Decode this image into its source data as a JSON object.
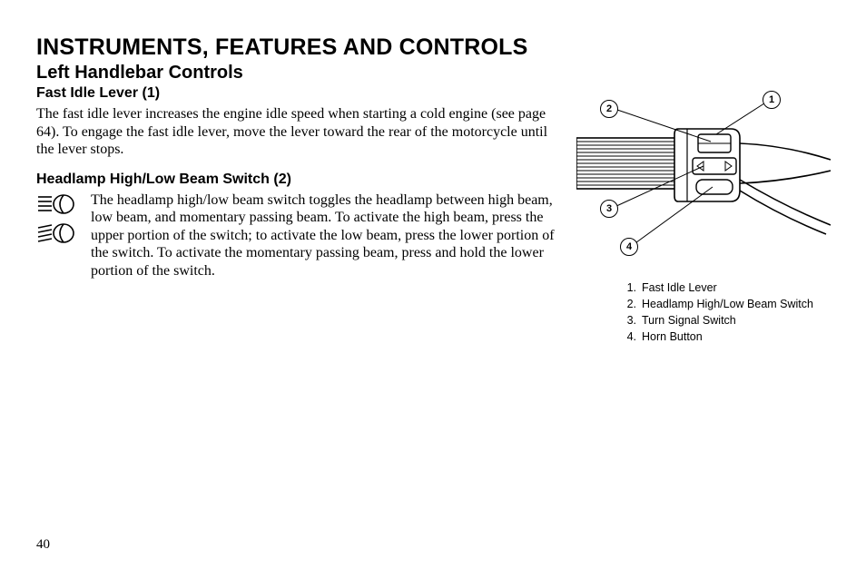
{
  "page_number": "40",
  "doc_title": "INSTRUMENTS, FEATURES AND CONTROLS",
  "section_title": "Left Handlebar Controls",
  "subsection1": {
    "title": "Fast Idle Lever (1)",
    "body": "The fast idle lever increases the engine idle speed when starting a cold engine (see page 64). To engage the fast idle lever, move the lever toward the rear of the motorcycle until the lever stops."
  },
  "subsection2": {
    "title": "Headlamp High/Low Beam Switch (2)",
    "body": "The headlamp high/low beam switch toggles the headlamp between high beam, low beam, and momentary passing beam. To activate the high beam, press the upper portion of the switch; to activate the low beam, press the lower portion of the switch. To activate the momentary passing beam, press and hold the lower portion of the switch."
  },
  "callouts": {
    "c1": "1",
    "c2": "2",
    "c3": "3",
    "c4": "4"
  },
  "legend": [
    {
      "n": "1.",
      "t": "Fast Idle Lever"
    },
    {
      "n": "2.",
      "t": "Headlamp High/Low Beam Switch"
    },
    {
      "n": "3.",
      "t": "Turn Signal Switch"
    },
    {
      "n": "4.",
      "t": "Horn Button"
    }
  ]
}
